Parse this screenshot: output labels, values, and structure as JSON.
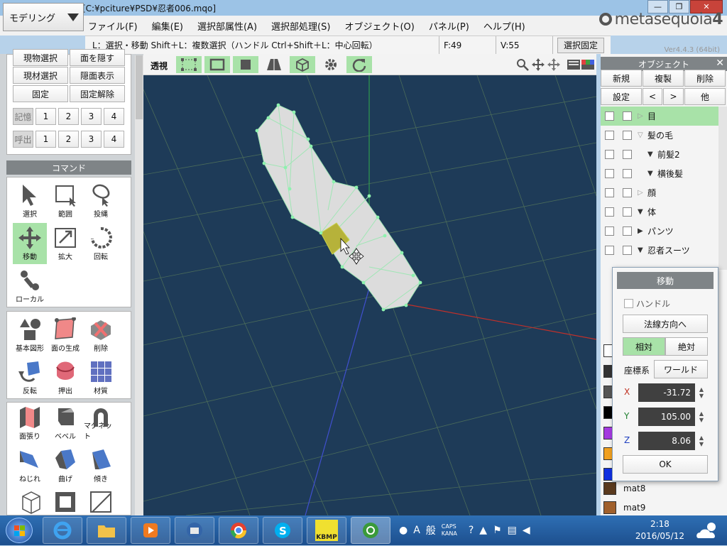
{
  "window": {
    "title": "Metasequoia 4 [C:¥pciture¥PSD¥忍者006.mqo]",
    "buttons": {
      "minimize": "—",
      "maximize": "❐",
      "close": "✕"
    }
  },
  "mode_selector": {
    "value": "モデリング"
  },
  "menu": [
    "ファイル(F)",
    "編集(E)",
    "選択部属性(A)",
    "選択部処理(S)",
    "オブジェクト(O)",
    "パネル(P)",
    "ヘルプ(H)"
  ],
  "logo": {
    "text": "metasequoia",
    "num": "4",
    "version": "Ver4.4.3 (64bit)"
  },
  "status": {
    "hint": "L：選択・移動  Shift＋L：複数選択（ハンドル  Ctrl+Shift＋L：中心回転）",
    "faces": "F:49",
    "vertices": "V:55",
    "lock_button": "選択固定"
  },
  "left_panel": {
    "row1": [
      "現物選択",
      "面を隠す"
    ],
    "row2": [
      "現材選択",
      "隠面表示"
    ],
    "row3": [
      "固定",
      "固定解除"
    ],
    "memory_label": "記憶",
    "recall_label": "呼出",
    "slots": [
      "1",
      "2",
      "3",
      "4"
    ],
    "command_header": "コマンド",
    "tools": [
      {
        "label": "選択",
        "icon": "arrow-cursor-icon"
      },
      {
        "label": "範囲",
        "icon": "rect-select-icon"
      },
      {
        "label": "投縄",
        "icon": "lasso-icon"
      },
      {
        "label": "移動",
        "icon": "move-icon",
        "active": true
      },
      {
        "label": "拡大",
        "icon": "scale-icon"
      },
      {
        "label": "回転",
        "icon": "rotate-icon"
      },
      {
        "label": "ローカル",
        "icon": "local-icon"
      },
      {
        "label": "基本図形",
        "icon": "primitive-icon"
      },
      {
        "label": "面の生成",
        "icon": "create-face-icon"
      },
      {
        "label": "削除",
        "icon": "delete-icon"
      },
      {
        "label": "反転",
        "icon": "flip-icon"
      },
      {
        "label": "押出",
        "icon": "extrude-icon"
      },
      {
        "label": "材質",
        "icon": "material-icon"
      },
      {
        "label": "面張り",
        "icon": "face-fill-icon"
      },
      {
        "label": "ベベル",
        "icon": "bevel-icon"
      },
      {
        "label": "マグネット",
        "icon": "magnet-icon"
      },
      {
        "label": "ねじれ",
        "icon": "twist-icon"
      },
      {
        "label": "曲げ",
        "icon": "bend-icon"
      },
      {
        "label": "傾き",
        "icon": "slant-icon"
      }
    ]
  },
  "view_toolbar": {
    "perspective_label": "透視"
  },
  "objects_panel": {
    "header": "オブジェクト",
    "buttons_row1": [
      "新規",
      "複製",
      "削除"
    ],
    "buttons_row2": [
      "設定",
      "<",
      ">",
      "他"
    ],
    "items": [
      {
        "name": "目",
        "selected": true,
        "tri": "▷",
        "indent": 0
      },
      {
        "name": "髪の毛",
        "tri": "▽",
        "indent": 0
      },
      {
        "name": "前髪2",
        "tri": "▼",
        "indent": 1
      },
      {
        "name": "横後髪",
        "tri": "▼",
        "indent": 1
      },
      {
        "name": "顔",
        "tri": "▷",
        "indent": 0
      },
      {
        "name": "体",
        "tri": "▼",
        "indent": 0
      },
      {
        "name": "パンツ",
        "tri": "▶",
        "indent": 0
      },
      {
        "name": "忍者スーツ",
        "tri": "▼",
        "indent": 0
      }
    ]
  },
  "materials": [
    {
      "name": "mat8",
      "color": "#5a3a1e"
    },
    {
      "name": "mat9",
      "color": "#a0602c"
    }
  ],
  "material_swatches": [
    "#ffffff",
    "#333333",
    "#555555",
    "#000000",
    "#a43ae0",
    "#f0a020",
    "#1030e0"
  ],
  "move_dialog": {
    "title": "移動",
    "handle_label": "ハンドル",
    "normal_button": "法線方向へ",
    "relative": "相対",
    "absolute": "絶対",
    "coord_label": "座標系",
    "coord_value": "ワールド",
    "x_label": "X",
    "x_value": "-31.72",
    "y_label": "Y",
    "y_value": "105.00",
    "z_label": "Z",
    "z_value": "8.06",
    "ok": "OK"
  },
  "taskbar": {
    "ime": {
      "mode": "A",
      "kanji": "般",
      "caps": "CAPS",
      "kana": "KANA"
    },
    "time": "2:18",
    "date": "2016/05/12",
    "kbmp": "KBMP"
  },
  "colors": {
    "accent_green": "#a8e2a8",
    "viewport_bg": "#1e3b58",
    "header_gray": "#7f8487"
  }
}
